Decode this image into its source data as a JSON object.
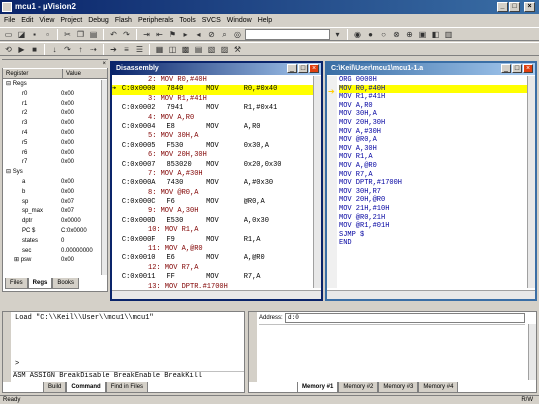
{
  "app": {
    "title": "mcu1 - µVision2",
    "status_left": "Ready",
    "status_right": "R/W"
  },
  "menu": [
    "File",
    "Edit",
    "View",
    "Project",
    "Debug",
    "Flash",
    "Peripherals",
    "Tools",
    "SVCS",
    "Window",
    "Help"
  ],
  "registers": {
    "header_name": "Register",
    "header_value": "Value",
    "rows": [
      {
        "n": "Regs",
        "v": "",
        "d": 0,
        "g": "minus"
      },
      {
        "n": "r0",
        "v": "0x00",
        "d": 2,
        "g": ""
      },
      {
        "n": "r1",
        "v": "0x00",
        "d": 2,
        "g": ""
      },
      {
        "n": "r2",
        "v": "0x00",
        "d": 2,
        "g": ""
      },
      {
        "n": "r3",
        "v": "0x00",
        "d": 2,
        "g": ""
      },
      {
        "n": "r4",
        "v": "0x00",
        "d": 2,
        "g": ""
      },
      {
        "n": "r5",
        "v": "0x00",
        "d": 2,
        "g": ""
      },
      {
        "n": "r6",
        "v": "0x00",
        "d": 2,
        "g": ""
      },
      {
        "n": "r7",
        "v": "0x00",
        "d": 2,
        "g": ""
      },
      {
        "n": "Sys",
        "v": "",
        "d": 0,
        "g": "minus"
      },
      {
        "n": "a",
        "v": "0x00",
        "d": 2,
        "g": ""
      },
      {
        "n": "b",
        "v": "0x00",
        "d": 2,
        "g": ""
      },
      {
        "n": "sp",
        "v": "0x07",
        "d": 2,
        "g": ""
      },
      {
        "n": "sp_max",
        "v": "0x07",
        "d": 2,
        "g": ""
      },
      {
        "n": "dptr",
        "v": "0x0000",
        "d": 2,
        "g": ""
      },
      {
        "n": "PC $",
        "v": "C:0x0000",
        "d": 2,
        "g": ""
      },
      {
        "n": "states",
        "v": "0",
        "d": 2,
        "g": ""
      },
      {
        "n": "sec",
        "v": "0.00000000",
        "d": 2,
        "g": ""
      },
      {
        "n": "psw",
        "v": "0x00",
        "d": 1,
        "g": "plus"
      }
    ],
    "tabs": [
      "Files",
      "Regs",
      "Books"
    ]
  },
  "disasm": {
    "title": "Disassembly",
    "rows": [
      {
        "t": "src",
        "txt": "2: MOV R0,#40H"
      },
      {
        "t": "ins",
        "addr": "C:0x0000",
        "hex": "7840",
        "op": "MOV",
        "args": "R0,#0x40",
        "cur": true
      },
      {
        "t": "src",
        "txt": "3: MOV R1,#41H"
      },
      {
        "t": "ins",
        "addr": "C:0x0002",
        "hex": "7941",
        "op": "MOV",
        "args": "R1,#0x41"
      },
      {
        "t": "src",
        "txt": "4: MOV A,R0"
      },
      {
        "t": "ins",
        "addr": "C:0x0004",
        "hex": "E8",
        "op": "MOV",
        "args": "A,R0"
      },
      {
        "t": "src",
        "txt": "5: MOV 30H,A"
      },
      {
        "t": "ins",
        "addr": "C:0x0005",
        "hex": "F530",
        "op": "MOV",
        "args": "0x30,A"
      },
      {
        "t": "src",
        "txt": "6: MOV 20H,30H"
      },
      {
        "t": "ins",
        "addr": "C:0x0007",
        "hex": "853020",
        "op": "MOV",
        "args": "0x20,0x30"
      },
      {
        "t": "src",
        "txt": "7: MOV A,#30H"
      },
      {
        "t": "ins",
        "addr": "C:0x000A",
        "hex": "7430",
        "op": "MOV",
        "args": "A,#0x30"
      },
      {
        "t": "src",
        "txt": "8: MOV @R0,A"
      },
      {
        "t": "ins",
        "addr": "C:0x000C",
        "hex": "F6",
        "op": "MOV",
        "args": "@R0,A"
      },
      {
        "t": "src",
        "txt": "9: MOV A,30H"
      },
      {
        "t": "ins",
        "addr": "C:0x000D",
        "hex": "E530",
        "op": "MOV",
        "args": "A,0x30"
      },
      {
        "t": "src",
        "txt": "10: MOV R1,A"
      },
      {
        "t": "ins",
        "addr": "C:0x000F",
        "hex": "F9",
        "op": "MOV",
        "args": "R1,A"
      },
      {
        "t": "src",
        "txt": "11: MOV A,@R0"
      },
      {
        "t": "ins",
        "addr": "C:0x0010",
        "hex": "E6",
        "op": "MOV",
        "args": "A,@R0"
      },
      {
        "t": "src",
        "txt": "12: MOV R7,A"
      },
      {
        "t": "ins",
        "addr": "C:0x0011",
        "hex": "FF",
        "op": "MOV",
        "args": "R7,A"
      },
      {
        "t": "src",
        "txt": "13: MOV DPTR,#1700H"
      },
      {
        "t": "ins",
        "addr": "C:0x0012",
        "hex": "901700",
        "op": "MOV",
        "args": "DPTR,#0x17"
      },
      {
        "t": "src",
        "txt": "14: MOV 30H,R7"
      },
      {
        "t": "ins",
        "addr": "C:0x0015",
        "hex": "8F30",
        "op": "MOV",
        "args": "0x30,R7"
      }
    ]
  },
  "source": {
    "title": "C:\\Keil\\User\\mcu1\\mcu1-1.a",
    "lines": [
      "ORG 0000H",
      "MOV R0,#40H",
      "MOV R1,#41H",
      "MOV A,R0",
      "MOV 30H,A",
      "MOV 20H,30H",
      "MOV A,#30H",
      "MOV @R0,A",
      "MOV A,30H",
      "MOV R1,A",
      "MOV A,@R0",
      "MOV R7,A",
      "MOV DPTR,#1700H",
      "MOV 30H,R7",
      "MOV 20H,@R0",
      "MOV 21H,#10H",
      "MOV @R0,21H",
      "MOV @R1,#01H",
      "SJMP $",
      "END"
    ]
  },
  "output": {
    "line1": "Load \"C:\\\\Keil\\\\User\\\\mcu1\\\\mcu1\"",
    "prompt": ">",
    "commands": "ASM ASSIGN BreakDisable BreakEnable BreakKill",
    "tabs": [
      "Build",
      "Command",
      "Find in Files"
    ]
  },
  "memory": {
    "label": "Address:",
    "value": "d:0",
    "tabs": [
      "Memory #1",
      "Memory #2",
      "Memory #3",
      "Memory #4"
    ]
  },
  "colors": {
    "title_active": "#0a246a",
    "source_text": "#0000a0",
    "disasm_source": "#800000",
    "current_line": "#ffff00"
  }
}
